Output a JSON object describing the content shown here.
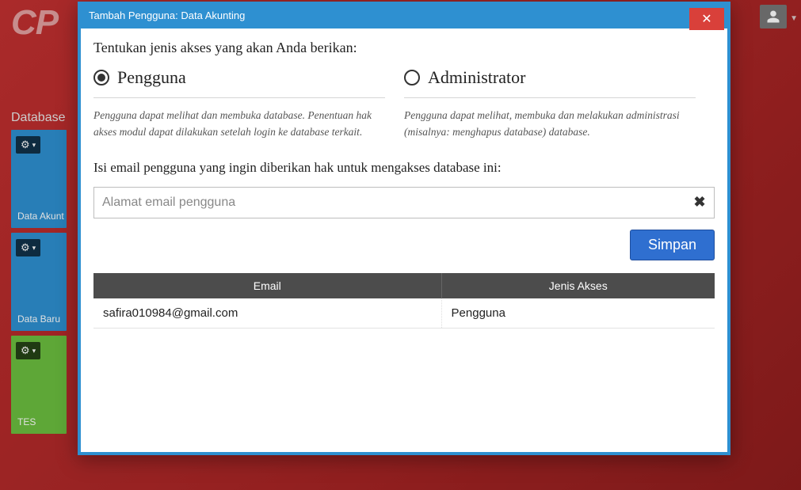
{
  "background": {
    "logo": "CP",
    "section_label": "Database",
    "tiles": [
      {
        "caption": "Data Akunt",
        "color": "blue"
      },
      {
        "caption": "Data Baru",
        "color": "blue"
      },
      {
        "caption": "TES",
        "color": "green"
      }
    ]
  },
  "modal": {
    "title": "Tambah Pengguna: Data Akunting",
    "prompt_access": "Tentukan jenis akses yang akan Anda berikan:",
    "options": {
      "user": {
        "label": "Pengguna",
        "selected": true,
        "description": "Pengguna dapat melihat dan membuka database. Penentuan hak akses modul dapat dilakukan setelah login ke database terkait."
      },
      "admin": {
        "label": "Administrator",
        "selected": false,
        "description": "Pengguna dapat melihat, membuka dan melakukan administrasi (misalnya: menghapus database) database."
      }
    },
    "prompt_email": "Isi email pengguna yang ingin diberikan hak untuk mengakses database ini:",
    "email_placeholder": "Alamat email pengguna",
    "email_value": "",
    "save_label": "Simpan",
    "table": {
      "headers": {
        "email": "Email",
        "access": "Jenis Akses"
      },
      "rows": [
        {
          "email": "safira010984@gmail.com",
          "access": "Pengguna"
        }
      ]
    }
  }
}
